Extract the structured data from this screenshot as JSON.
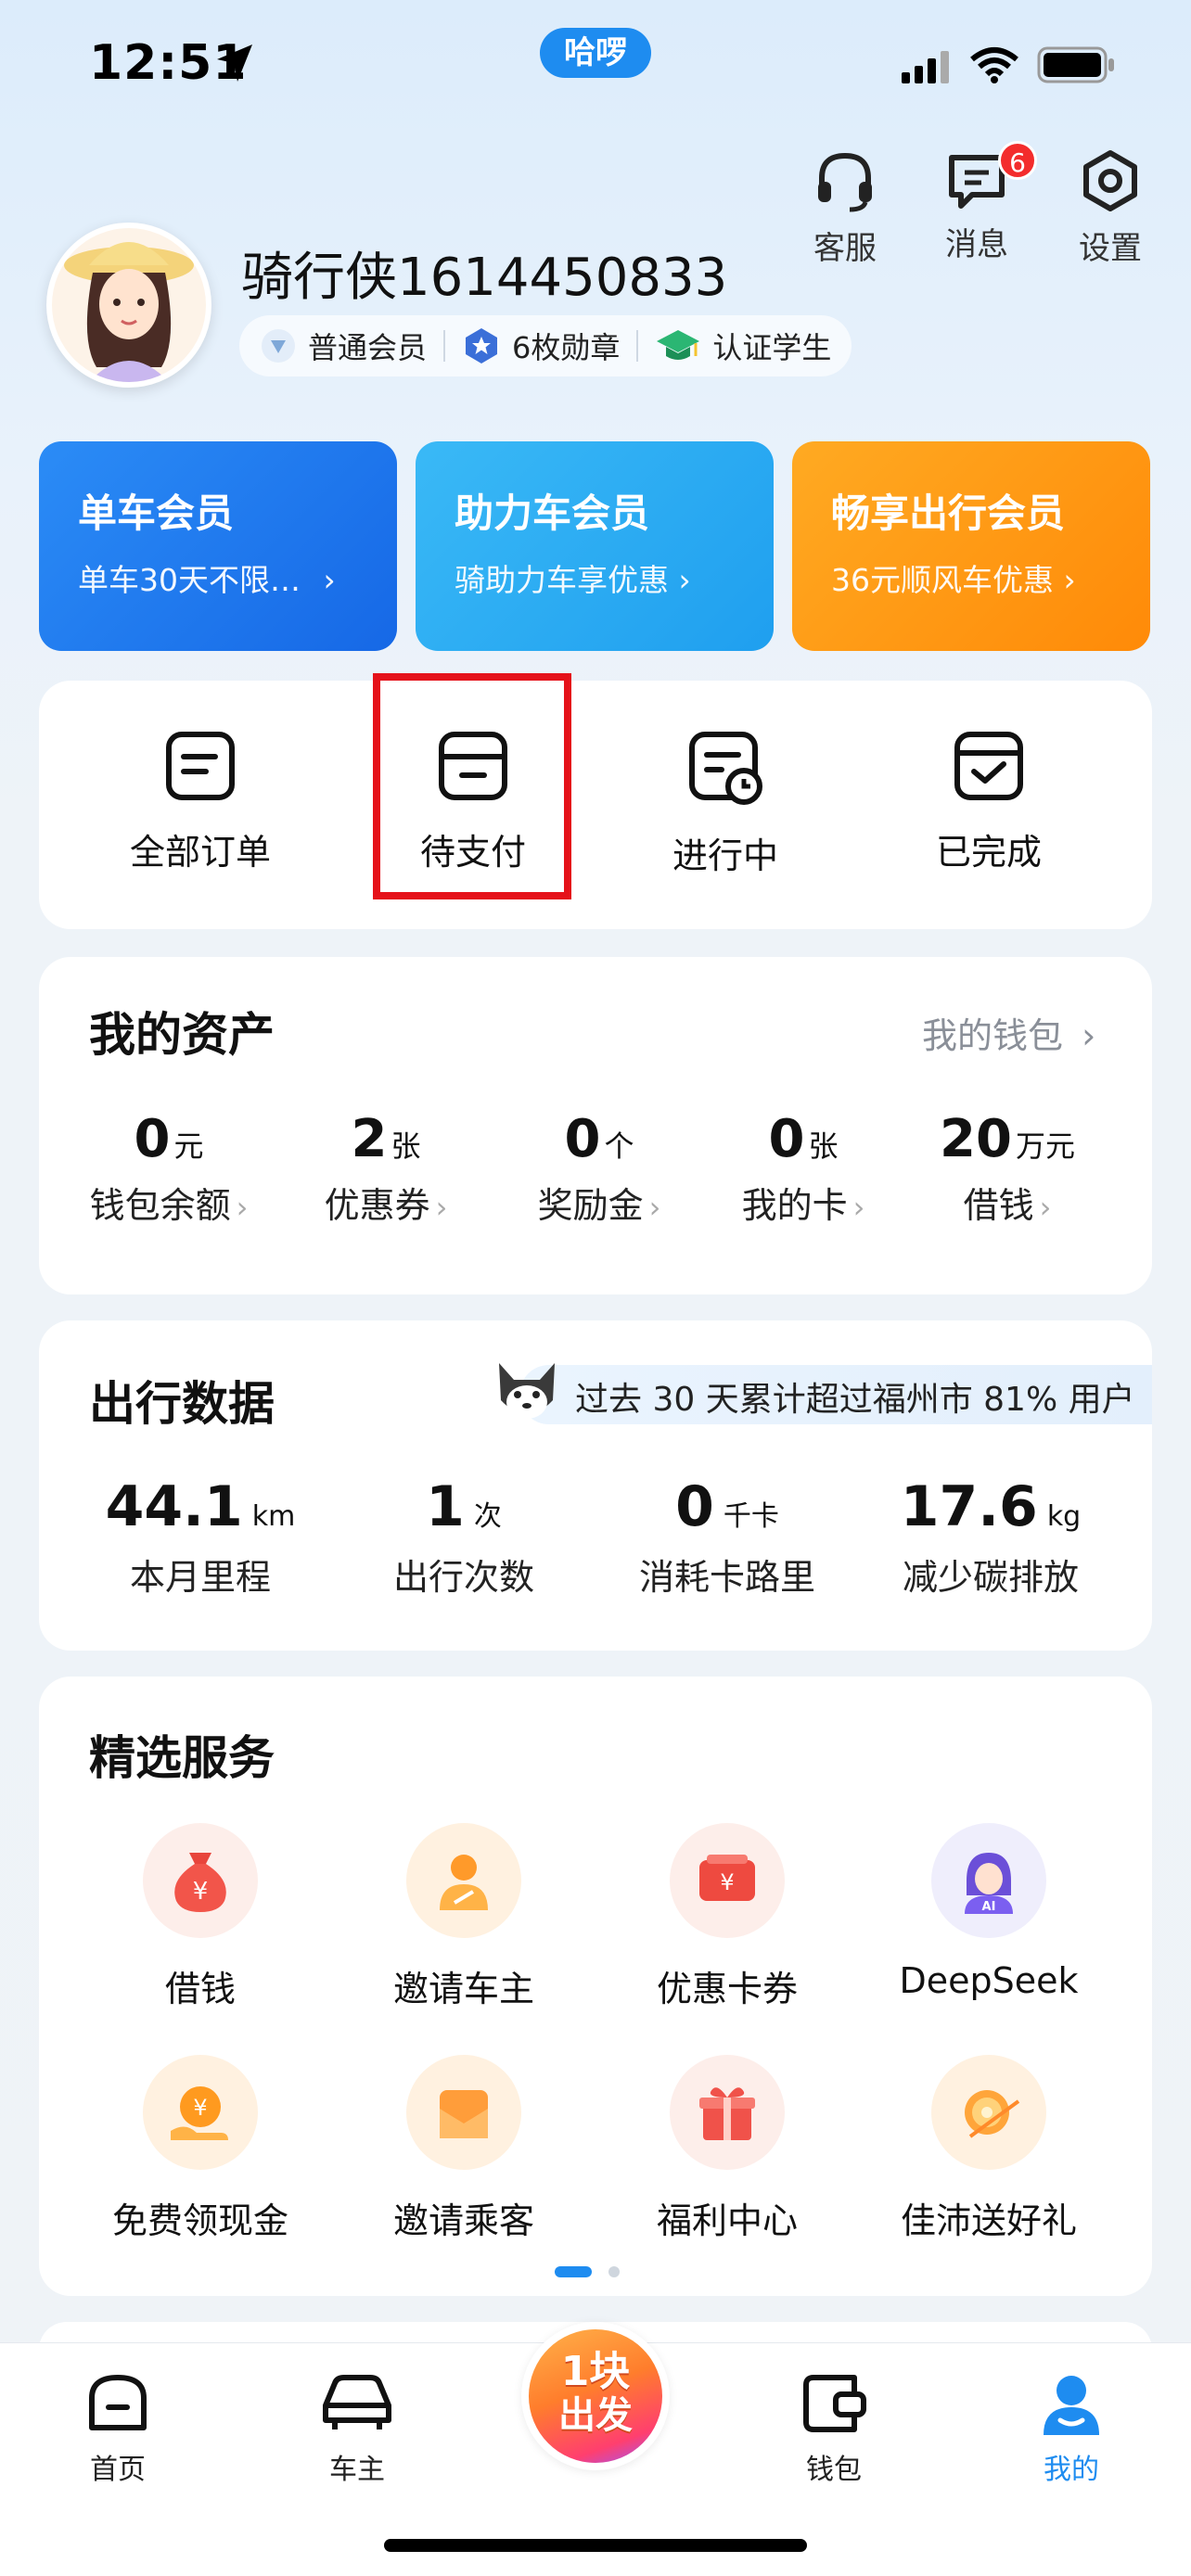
{
  "status_bar": {
    "time": "12:51",
    "pill": "哈啰"
  },
  "header": {
    "service_label": "客服",
    "message_label": "消息",
    "message_badge": "6",
    "settings_label": "设置"
  },
  "profile": {
    "username": "骑行侠1614450833",
    "tags": [
      "普通会员",
      "6枚勋章",
      "认证学生"
    ]
  },
  "memberships": [
    {
      "title": "单车会员",
      "subtitle": "单车30天不限…",
      "color": "#1f7ef0"
    },
    {
      "title": "助力车会员",
      "subtitle": "骑助力车享优惠",
      "color": "#2aa8f2"
    },
    {
      "title": "畅享出行会员",
      "subtitle": "36元顺风车优惠",
      "color": "#ff9a12"
    }
  ],
  "orders": [
    {
      "label": "全部订单",
      "icon": "order-list-icon"
    },
    {
      "label": "待支付",
      "icon": "wallet-card-icon"
    },
    {
      "label": "进行中",
      "icon": "clock-doc-icon"
    },
    {
      "label": "已完成",
      "icon": "check-doc-icon"
    }
  ],
  "assets": {
    "title": "我的资产",
    "wallet_link": "我的钱包",
    "items": [
      {
        "value": "0",
        "unit": "元",
        "label": "钱包余额"
      },
      {
        "value": "2",
        "unit": "张",
        "label": "优惠券"
      },
      {
        "value": "0",
        "unit": "个",
        "label": "奖励金"
      },
      {
        "value": "0",
        "unit": "张",
        "label": "我的卡"
      },
      {
        "value": "20",
        "unit": "万元",
        "label": "借钱"
      }
    ]
  },
  "travel": {
    "title": "出行数据",
    "banner": "过去 30 天累计超过福州市 81% 用户",
    "stats": [
      {
        "value": "44.1",
        "unit": "km",
        "label": "本月里程"
      },
      {
        "value": "1",
        "unit": "次",
        "label": "出行次数"
      },
      {
        "value": "0",
        "unit": "千卡",
        "label": "消耗卡路里"
      },
      {
        "value": "17.6",
        "unit": "kg",
        "label": "减少碳排放"
      }
    ]
  },
  "services": {
    "title": "精选服务",
    "items": [
      {
        "label": "借钱",
        "icon": "money-bag-icon"
      },
      {
        "label": "邀请车主",
        "icon": "driver-icon"
      },
      {
        "label": "优惠卡券",
        "icon": "coupon-icon"
      },
      {
        "label": "DeepSeek",
        "icon": "ai-avatar-icon"
      },
      {
        "label": "免费领现金",
        "icon": "cash-coin-icon"
      },
      {
        "label": "邀请乘客",
        "icon": "envelope-icon"
      },
      {
        "label": "福利中心",
        "icon": "gift-icon"
      },
      {
        "label": "佳沛送好礼",
        "icon": "kiwi-icon"
      }
    ]
  },
  "tabbar": {
    "home": "首页",
    "owner": "车主",
    "center_line1": "1块",
    "center_line2": "出发",
    "wallet": "钱包",
    "mine": "我的",
    "active_color": "#1e8cf0"
  }
}
